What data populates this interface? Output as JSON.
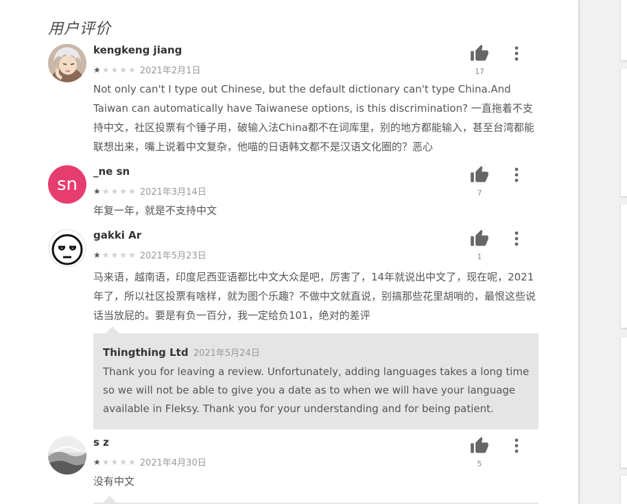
{
  "section_title": "用户评价",
  "reviews": [
    {
      "author": "kengkeng jiang",
      "date": "2021年2月1日",
      "rating": 1,
      "max_rating": 5,
      "likes": "17",
      "text": "Not only can't I type out Chinese, but the default dictionary can't type China.And Taiwan can automatically have Taiwanese options, is this discrimination? 一直拖着不支持中文，社区投票有个锤子用，破输入法China都不在词库里，别的地方都能输入，甚至台湾都能联想出来，嘴上说着中文复杂，他喵的日语韩文都不是汉语文化圈的？恶心",
      "avatar": "anime-character-avatar"
    },
    {
      "author": "_ne sn",
      "date": "2021年3月14日",
      "rating": 1,
      "max_rating": 5,
      "likes": "7",
      "text": "年复一年，就是不支持中文",
      "avatar_initials": "sn",
      "avatar_color": "#e63d70"
    },
    {
      "author": "gakki Ar",
      "date": "2021年5月23日",
      "rating": 1,
      "max_rating": 5,
      "likes": "1",
      "text": "马来语，越南语，印度尼西亚语都比中文大众是吧，厉害了，14年就说出中文了，现在呢，2021年了，所以社区投票有啥样，就为图个乐趣？不做中文就直说，别搞那些花里胡哨的，最恨这些说话当放屁的。要是有负一百分，我一定给负101，绝对的差评",
      "avatar": "meh-face-avatar"
    },
    {
      "author": "s z",
      "date": "2021年4月30日",
      "rating": 1,
      "max_rating": 5,
      "likes": "5",
      "text": "没有中文",
      "avatar": "landscape-photo-avatar"
    }
  ],
  "developer_reply": {
    "author": "Thingthing Ltd",
    "date": "2021年5月24日",
    "text": "Thank you for leaving a review. Unfortunately, adding languages takes a long time so we will not be able to give you a date as to when we will have your language available in Fleksy. Thank you for your understanding and for being patient."
  },
  "colors": {
    "icon_gray": "#666666",
    "star_filled": "#555555",
    "star_empty": "#d0d0d0",
    "reply_bg": "#e5e5e5",
    "avatar_pink": "#e63d70"
  }
}
